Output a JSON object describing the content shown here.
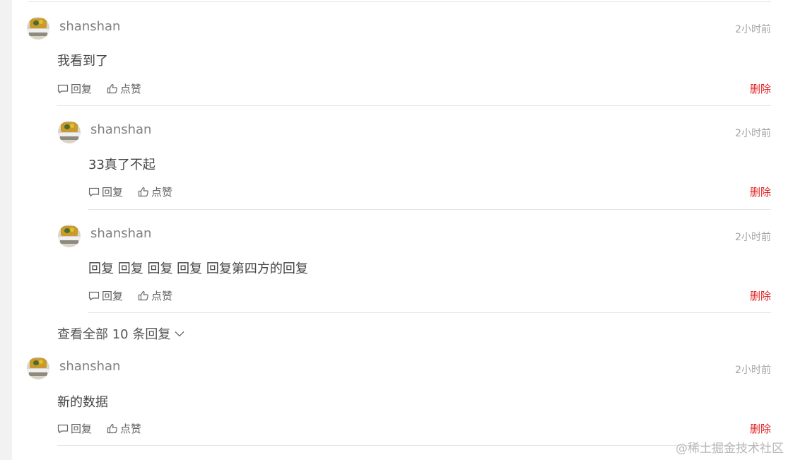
{
  "comments": [
    {
      "username": "shanshan",
      "time": "2小时前",
      "content": "我看到了",
      "reply_label": "回复",
      "like_label": "点赞",
      "delete_label": "删除",
      "replies": [
        {
          "username": "shanshan",
          "time": "2小时前",
          "content": "33真了不起",
          "reply_label": "回复",
          "like_label": "点赞",
          "delete_label": "删除"
        },
        {
          "username": "shanshan",
          "time": "2小时前",
          "content": "回复 回复 回复 回复 回复第四方的回复",
          "reply_label": "回复",
          "like_label": "点赞",
          "delete_label": "删除"
        }
      ],
      "view_all_label": "查看全部 10 条回复"
    },
    {
      "username": "shanshan",
      "time": "2小时前",
      "content": "新的数据",
      "reply_label": "回复",
      "like_label": "点赞",
      "delete_label": "删除"
    }
  ],
  "watermark": "@稀土掘金技术社区",
  "colors": {
    "delete": "#e02020",
    "background": "#f2f2f2",
    "panel": "#ffffff"
  },
  "icons": [
    "comment-icon",
    "thumbs-up-icon",
    "chevron-down-icon"
  ]
}
